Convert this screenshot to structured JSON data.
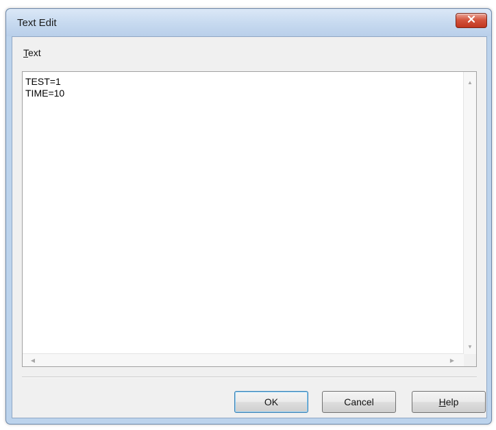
{
  "window": {
    "title": "Text Edit"
  },
  "label": {
    "mnemonic": "T",
    "rest": "ext"
  },
  "editor": {
    "value": "TEST=1\nTIME=10"
  },
  "buttons": {
    "ok": "OK",
    "cancel": "Cancel",
    "help_mnemonic": "H",
    "help_rest": "elp"
  },
  "icons": {
    "close": "close-icon",
    "scroll_up": "scroll-up-arrow-icon",
    "scroll_down": "scroll-down-arrow-icon",
    "scroll_left": "scroll-left-arrow-icon",
    "scroll_right": "scroll-right-arrow-icon"
  },
  "colors": {
    "titlebar": "#c6d9ef",
    "close_button": "#d4553e",
    "default_button_border": "#3c7fb1"
  }
}
